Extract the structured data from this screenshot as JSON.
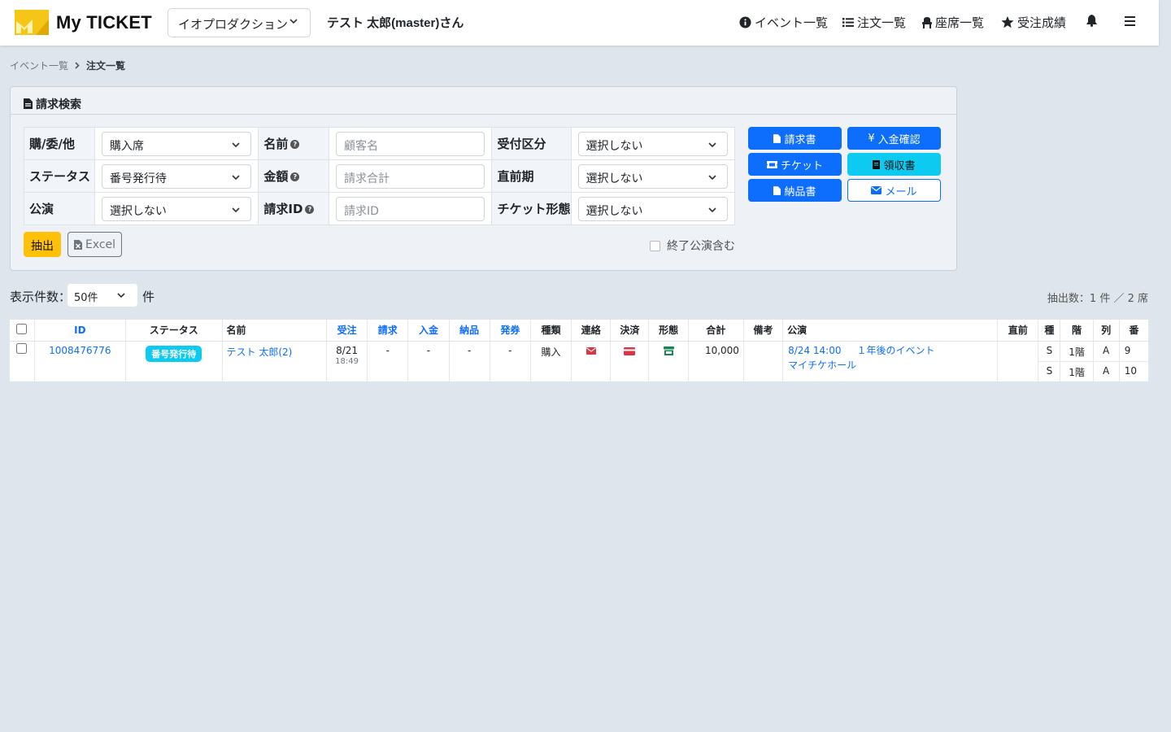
{
  "header": {
    "brand": "My TICKET",
    "org_select": "イオプロダクション",
    "user": "テスト 太郎(master)さん",
    "nav": {
      "events": "イベント一覧",
      "orders": "注文一覧",
      "seats": "座席一覧",
      "results": "受注成績"
    }
  },
  "breadcrumb": {
    "parent": "イベント一覧",
    "current": "注文一覧"
  },
  "search": {
    "title": "請求検索",
    "rows": [
      {
        "label1": "購/委/他",
        "value1": "購入席",
        "label2": "名前",
        "placeholder2": "顧客名",
        "label3": "受付区分",
        "value3": "選択しない"
      },
      {
        "label1": "ステータス",
        "value1": "番号発行待",
        "label2": "金額",
        "placeholder2": "請求合計",
        "label3": "直前期",
        "value3": "選択しない"
      },
      {
        "label1": "公演",
        "value1": "選択しない",
        "label2": "請求ID",
        "placeholder2": "請求ID",
        "label3": "チケット形態",
        "value3": "選択しない"
      }
    ],
    "buttons": {
      "invoice": "請求書",
      "payment_confirm": "入金確認",
      "ticket": "チケット",
      "receipt": "領収書",
      "delivery": "納品書",
      "mail": "メール",
      "extract": "抽出",
      "excel": "Excel"
    },
    "include_ended": "終了公演含む"
  },
  "listing": {
    "per_page_label": "表示件数：",
    "per_page_value": "50件",
    "per_page_unit": "件",
    "extract_count": "抽出数：1 件 ／ 2 席"
  },
  "table": {
    "headers": {
      "id": "ID",
      "status": "ステータス",
      "name": "名前",
      "order": "受注",
      "bill": "請求",
      "payment": "入金",
      "delivery": "納品",
      "issue": "発券",
      "kind": "種類",
      "contact": "連絡",
      "settle": "決済",
      "form": "形態",
      "total": "合計",
      "note": "備考",
      "performance": "公演",
      "just_before": "直前",
      "type": "種",
      "floor": "階",
      "row": "列",
      "number": "番"
    },
    "rows": [
      {
        "id": "1008476776",
        "status": "番号発行待",
        "name": "テスト 太郎(2)",
        "order_date": "8/21",
        "order_time": "18:49",
        "bill": "-",
        "payment": "-",
        "delivery": "-",
        "issue": "-",
        "kind": "購入",
        "total": "10,000",
        "performance_date": "8/24 14:00",
        "performance_title": "１年後のイベント",
        "venue": "マイチケホール",
        "seats": [
          {
            "type": "S",
            "floor": "1階",
            "row": "A",
            "number": "9"
          },
          {
            "type": "S",
            "floor": "1階",
            "row": "A",
            "number": "10"
          }
        ]
      }
    ]
  },
  "colors": {
    "primary": "#0d6efd",
    "info": "#0dcaf0",
    "warning": "#ffc107",
    "danger": "#dc3545",
    "success": "#198754",
    "background": "#dfe5ec"
  }
}
